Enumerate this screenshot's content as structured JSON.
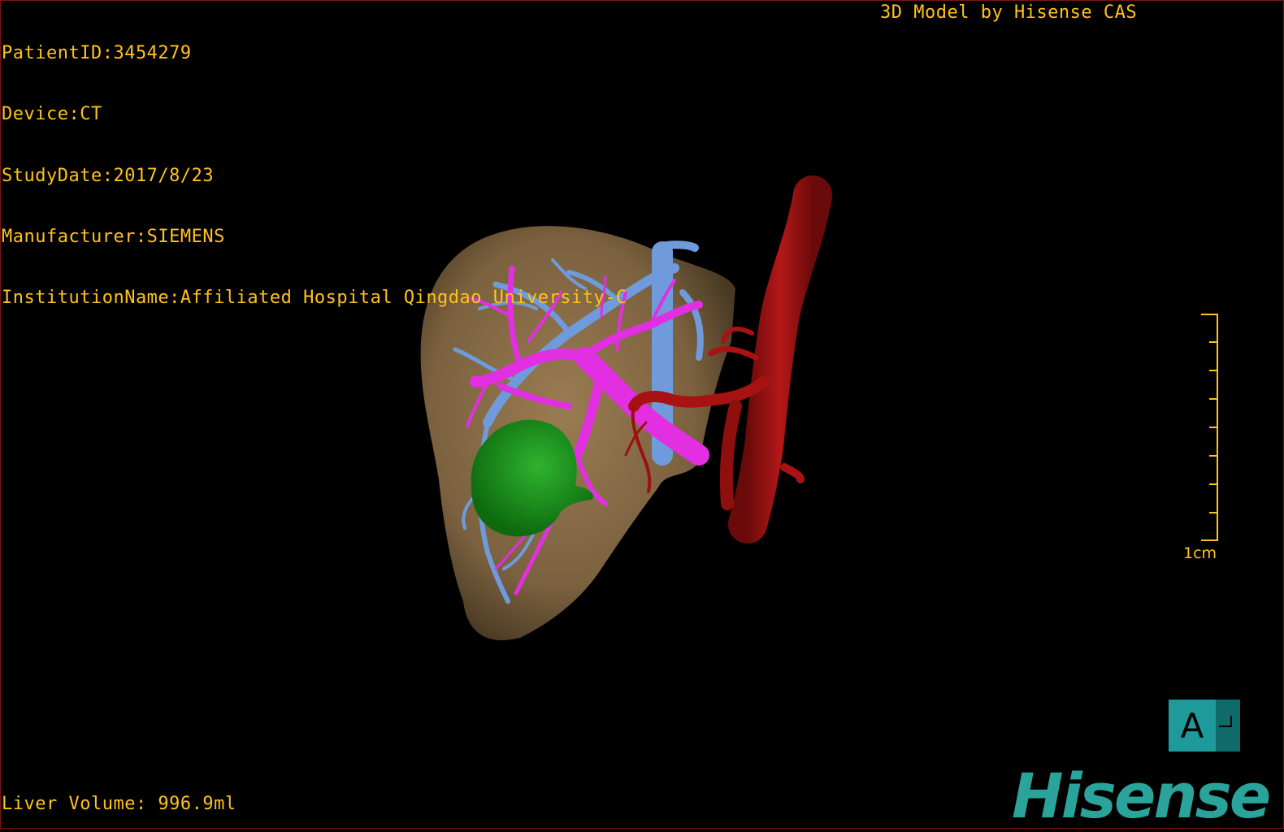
{
  "metadata": {
    "patient_id": "PatientID:3454279",
    "device": "Device:CT",
    "study_date": "StudyDate:2017/8/23",
    "manufacturer": "Manufacturer:SIEMENS",
    "institution": "InstitutionName:Affiliated Hospital Qingdao University-C"
  },
  "brand_top": "3D Model by Hisense CAS",
  "liver_volume": "Liver Volume: 996.9ml",
  "scale_bar": {
    "label": "1cm",
    "ticks": 9
  },
  "orientation": {
    "label": "A"
  },
  "logo": "Hisense",
  "colors": {
    "text": "#ffc21c",
    "liver": "#8a6e48",
    "portal_vein": "#e02ee0",
    "hepatic_vein": "#6a96d8",
    "artery": "#9c1010",
    "tumor": "#1a8a1a",
    "logo": "#2aa39a"
  }
}
